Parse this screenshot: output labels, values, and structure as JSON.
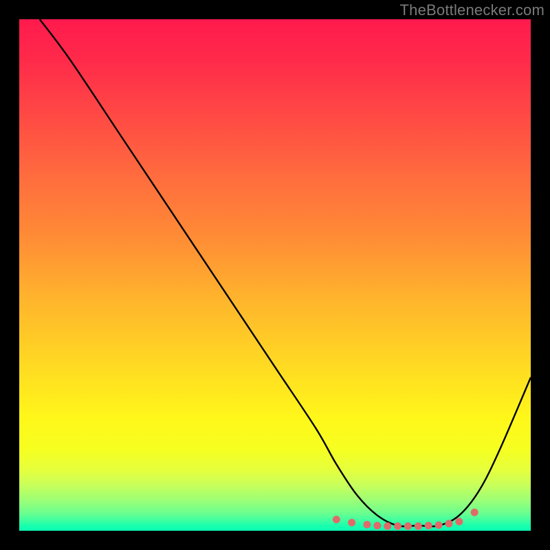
{
  "watermark": "TheBottlenecker.com",
  "chart_data": {
    "type": "line",
    "title": "",
    "xlabel": "",
    "ylabel": "",
    "xlim": [
      0,
      100
    ],
    "ylim": [
      0,
      100
    ],
    "gradient_stops": [
      {
        "pct": 0,
        "color": "#ff1a4d"
      },
      {
        "pct": 18,
        "color": "#ff4745"
      },
      {
        "pct": 42,
        "color": "#ff8a36"
      },
      {
        "pct": 67,
        "color": "#ffd823"
      },
      {
        "pct": 84,
        "color": "#f6ff20"
      },
      {
        "pct": 94,
        "color": "#9dff76"
      },
      {
        "pct": 100,
        "color": "#08ffb4"
      }
    ],
    "series": [
      {
        "name": "bottleneck-curve",
        "x": [
          4,
          10,
          20,
          30,
          40,
          50,
          58,
          62,
          66,
          70,
          74,
          78,
          82,
          86,
          90,
          94,
          100
        ],
        "y": [
          100,
          92,
          77,
          62,
          47,
          32,
          20,
          13,
          7,
          3,
          1,
          1,
          1,
          3,
          8,
          16,
          30
        ]
      }
    ],
    "marker_points": {
      "name": "flat-region-dots",
      "x": [
        62,
        65,
        68,
        70,
        72,
        74,
        76,
        78,
        80,
        82,
        84,
        86,
        89
      ],
      "y": [
        2.2,
        1.6,
        1.2,
        1.0,
        0.9,
        0.9,
        0.9,
        0.9,
        1.0,
        1.1,
        1.4,
        1.8,
        3.6
      ]
    },
    "marker_color": "#e06a6a"
  }
}
